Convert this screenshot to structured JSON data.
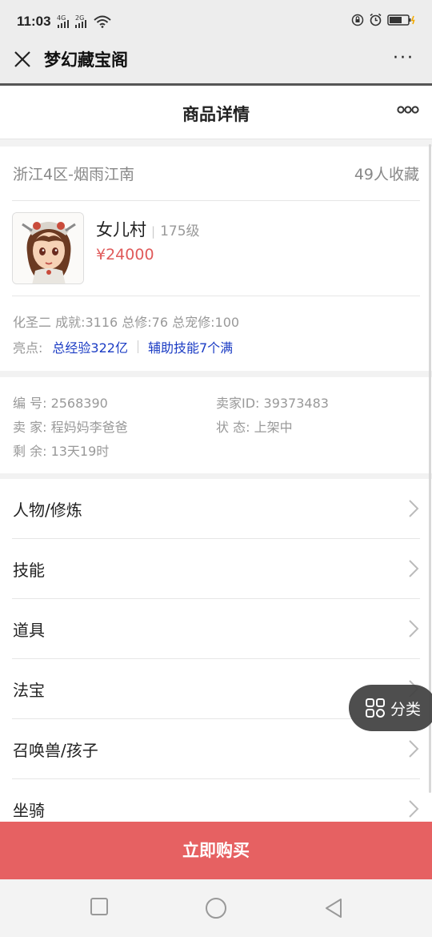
{
  "status_bar": {
    "time": "11:03",
    "signal1_label": "4G",
    "signal2_label": "2G"
  },
  "titlebar": {
    "title": "梦幻藏宝阁",
    "more": "···"
  },
  "page": {
    "title": "商品详情"
  },
  "summary": {
    "server": "浙江4区-烟雨江南",
    "favorites": "49人收藏",
    "role": "女儿村",
    "level": "175级",
    "price": "¥24000",
    "stats": "化圣二 成就:3116 总修:76 总宠修:100",
    "highlights_label": "亮点:",
    "highlights": [
      "总经验322亿",
      "辅助技能7个满"
    ]
  },
  "info": {
    "id": "编 号: 2568390",
    "seller_id": "卖家ID: 39373483",
    "seller": "卖 家: 程妈妈李爸爸",
    "status": "状 态: 上架中",
    "remaining": "剩 余: 13天19时"
  },
  "menu": {
    "items": [
      {
        "label": "人物/修炼"
      },
      {
        "label": "技能"
      },
      {
        "label": "道具"
      },
      {
        "label": "法宝"
      },
      {
        "label": "召唤兽/孩子"
      },
      {
        "label": "坐骑"
      }
    ]
  },
  "fab": {
    "label": "分类"
  },
  "buy_button": {
    "label": "立即购买"
  },
  "colors": {
    "accent_red": "#e66162",
    "price_red": "#e05a5a",
    "link_blue": "#1b3cc4"
  }
}
